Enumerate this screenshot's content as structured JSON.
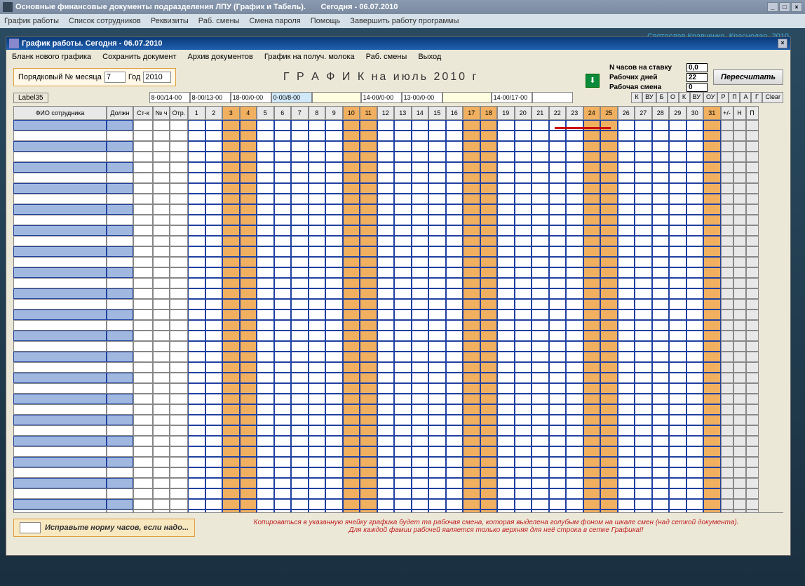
{
  "outer": {
    "title": "Основные финансовые документы подразделения ЛПУ (График и Табель).",
    "date_label": "Сегодня - 06.07.2010",
    "menu": [
      "График работы",
      "Список сотрудников",
      "Реквизиты",
      "Раб. смены",
      "Смена пароля",
      "Помощь",
      "Завершить работу программы"
    ]
  },
  "credit": "Святослав Кравченко, Краснодар, 2010.",
  "inner": {
    "title": "График работы.    Сегодня - 06.07.2010",
    "menu": [
      "Бланк нового графика",
      "Сохранить документ",
      "Архив документов",
      "График на получ. молока",
      "Раб. смены",
      "Выход"
    ]
  },
  "month": {
    "label": "Порядковый № месяца",
    "value": "7",
    "year_label": "Год",
    "year": "2010"
  },
  "title": "Г Р А Ф И К на      июль    2010 г",
  "stats": {
    "hours_label": "N часов на ставку",
    "hours": "0,0",
    "days_label": "Рабочих дней",
    "days": "22",
    "shift_label": "Рабочая смена",
    "shift": "0"
  },
  "recalc": "Пересчитать",
  "label35": "Label35",
  "shifts": [
    "8-00/14-00",
    "8-00/13-00",
    "18-00/0-00",
    "0-00/8-00",
    "",
    "14-00/0-00",
    "13-00/0-00",
    "",
    "14-00/17-00",
    ""
  ],
  "codes": [
    "К",
    "ВУ",
    "Б",
    "О",
    "К",
    "ВУ",
    "ОУ",
    "Р",
    "П",
    "А",
    "Г",
    "Clear"
  ],
  "headers": {
    "fio": "ФИО сотрудника",
    "dolj": "Должн",
    "stk": "Ст-к",
    "nch": "№ ч",
    "otr": "Отр."
  },
  "days": [
    1,
    2,
    3,
    4,
    5,
    6,
    7,
    8,
    9,
    10,
    11,
    12,
    13,
    14,
    15,
    16,
    17,
    18,
    19,
    20,
    21,
    22,
    23,
    24,
    25,
    26,
    27,
    28,
    29,
    30,
    31
  ],
  "weekends": [
    3,
    4,
    10,
    11,
    17,
    18,
    24,
    25,
    31
  ],
  "tail": [
    "+/-",
    "Н",
    "П"
  ],
  "rows": 19,
  "fix": {
    "label": "Исправьте норму часов, если надо..."
  },
  "hint1": "Копироваться в указанную ячейку графика будет та рабочая смена, которая выделена голубым фоном на шкале смен (над сеткой документа).",
  "hint2": "Для каждой фамии рабочей является только верхняя для неё строка в сетке Графика!!"
}
